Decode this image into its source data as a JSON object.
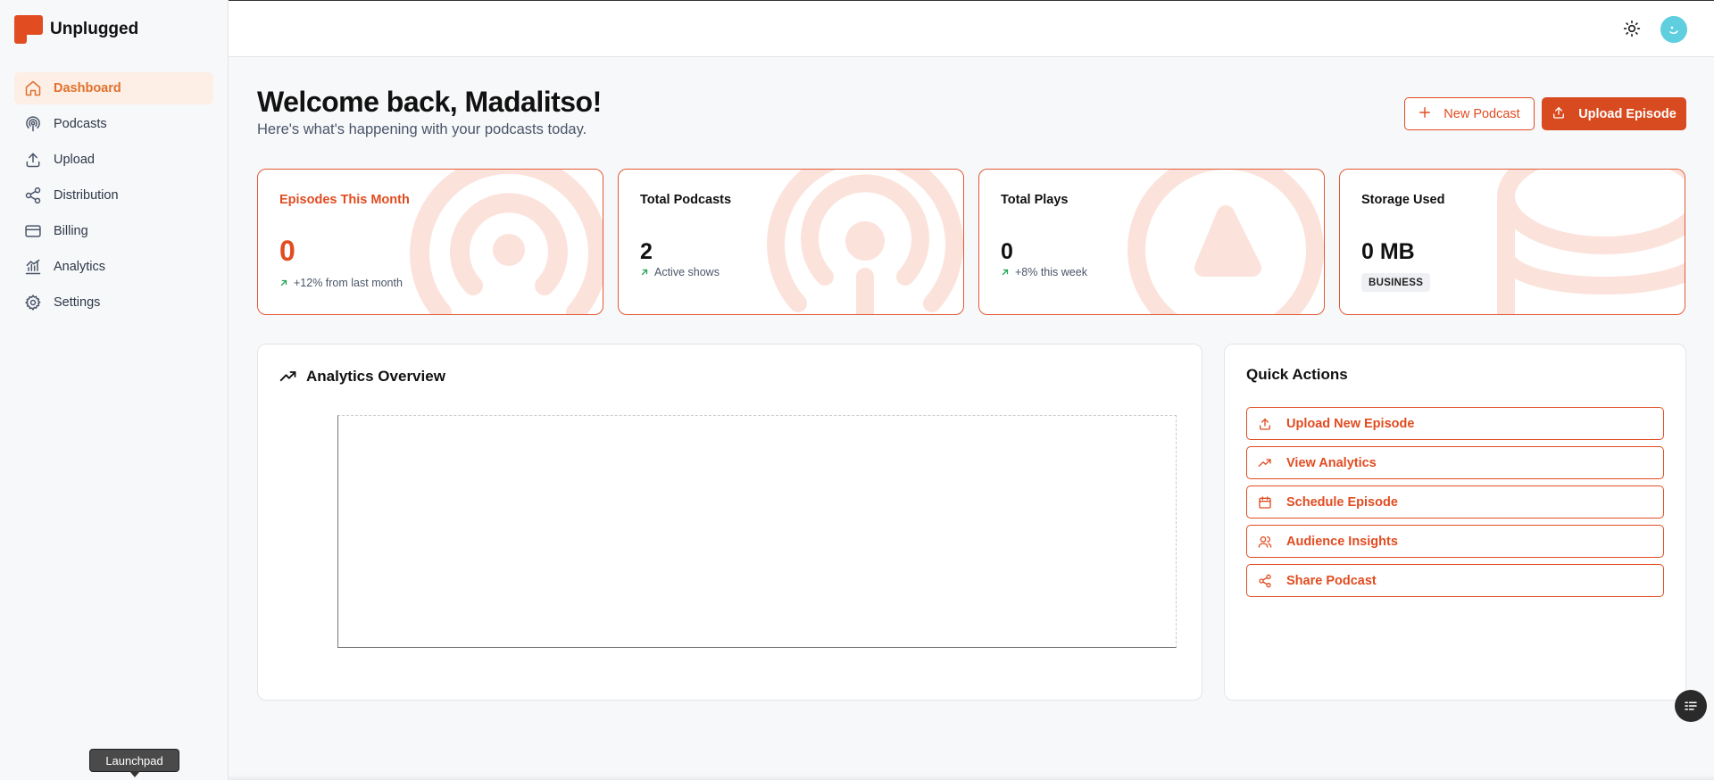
{
  "app": {
    "name": "Unplugged"
  },
  "sidebar": {
    "items": [
      {
        "label": "Dashboard",
        "icon": "home-icon",
        "active": true
      },
      {
        "label": "Podcasts",
        "icon": "podcast-icon"
      },
      {
        "label": "Upload",
        "icon": "upload-icon"
      },
      {
        "label": "Distribution",
        "icon": "share-icon"
      },
      {
        "label": "Billing",
        "icon": "credit-card-icon"
      },
      {
        "label": "Analytics",
        "icon": "bar-chart-icon"
      },
      {
        "label": "Settings",
        "icon": "gear-icon"
      }
    ],
    "launchpad_label": "Launchpad"
  },
  "header": {
    "theme_icon": "sun-icon",
    "avatar_icon": "avatar"
  },
  "main": {
    "title": "Welcome back, Madalitso!",
    "subtitle": "Here's what's happening with your podcasts today.",
    "new_podcast_label": "New Podcast",
    "upload_episode_label": "Upload Episode"
  },
  "stats": [
    {
      "label": "Episodes This Month",
      "value": "0",
      "sub": "+12% from last month"
    },
    {
      "label": "Total Podcasts",
      "value": "2",
      "sub": "Active shows"
    },
    {
      "label": "Total Plays",
      "value": "0",
      "sub": "+8% this week"
    },
    {
      "label": "Storage Used",
      "value": "0 MB",
      "badge": "BUSINESS"
    }
  ],
  "analytics": {
    "title": "Analytics Overview"
  },
  "quick_actions": {
    "title": "Quick Actions",
    "items": [
      {
        "label": "Upload New Episode",
        "icon": "upload-icon"
      },
      {
        "label": "View Analytics",
        "icon": "trending-up-icon"
      },
      {
        "label": "Schedule Episode",
        "icon": "calendar-icon"
      },
      {
        "label": "Audience Insights",
        "icon": "users-icon"
      },
      {
        "label": "Share Podcast",
        "icon": "share-icon"
      }
    ]
  },
  "colors": {
    "accent": "#e14c21",
    "active_nav_bg": "#fdeee6",
    "active_nav_text": "#e0722c"
  }
}
